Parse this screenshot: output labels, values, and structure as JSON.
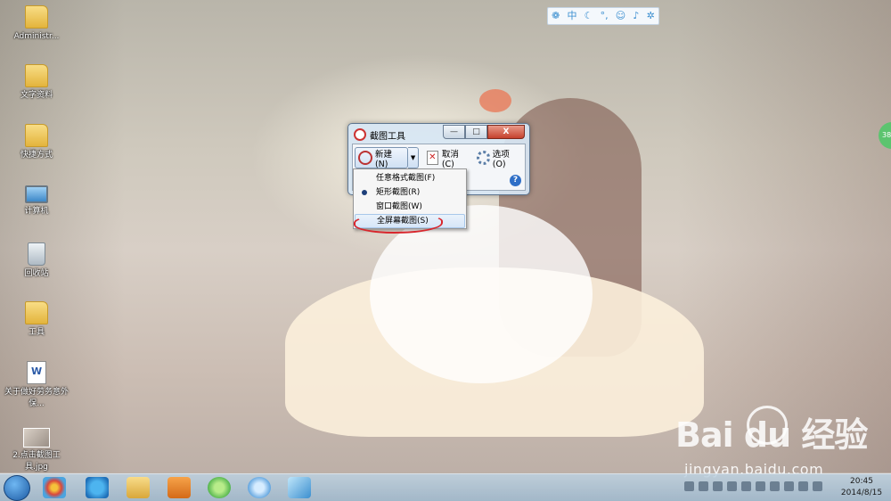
{
  "desktop": {
    "icons": [
      {
        "label": "Administr..."
      },
      {
        "label": "文字资料"
      },
      {
        "label": "快捷方式"
      },
      {
        "label": "计算机"
      },
      {
        "label": "回收站"
      },
      {
        "label": "工具"
      },
      {
        "label": "关于做好劳务意外保..."
      },
      {
        "label": "2.点击截图工具.jpg"
      }
    ]
  },
  "ime_bar": {
    "lang": "中"
  },
  "side_tab": {
    "label": "38"
  },
  "snipping_tool": {
    "title": "截图工具",
    "new_label": "新建(N)",
    "cancel_label": "取消(C)",
    "options_label": "选项(O)",
    "help": "?",
    "minimize": "—",
    "maximize": "□",
    "close": "X",
    "menu": [
      {
        "label": "任意格式截图(F)",
        "selected": false
      },
      {
        "label": "矩形截图(R)",
        "selected": true
      },
      {
        "label": "窗口截图(W)",
        "selected": false
      },
      {
        "label": "全屏幕截图(S)",
        "selected": false,
        "highlighted": true
      }
    ]
  },
  "watermark": {
    "logo": "Bai  du 经验",
    "url": "jingyan.baidu.com"
  },
  "taskbar": {
    "clock_time": "20:45",
    "clock_date": "2014/8/15"
  }
}
